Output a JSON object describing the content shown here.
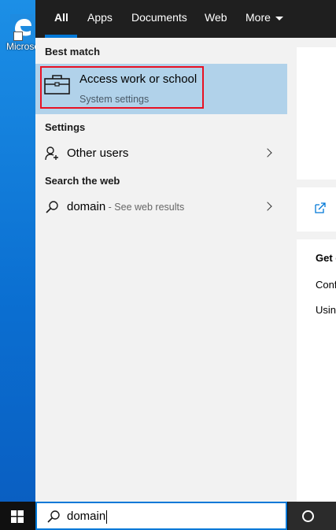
{
  "desktop": {
    "icon_label": "Microsoft Edge"
  },
  "tabs": [
    {
      "label": "All",
      "active": true
    },
    {
      "label": "Apps"
    },
    {
      "label": "Documents"
    },
    {
      "label": "Web"
    },
    {
      "label": "More"
    }
  ],
  "results": {
    "best_match_header": "Best match",
    "best_match": {
      "title": "Access work or school",
      "subtitle": "System settings",
      "icon": "briefcase-icon"
    },
    "settings_header": "Settings",
    "settings_items": [
      {
        "label": "Other users",
        "icon": "person-add-icon"
      }
    ],
    "web_header": "Search the web",
    "web_items": [
      {
        "query": "domain",
        "hint": " - See web results",
        "icon": "search-icon"
      }
    ]
  },
  "preview": {
    "heading_partial": "Get d",
    "line1_partial": "Conf",
    "line2_partial": "Usin"
  },
  "taskbar": {
    "search_value": "domain"
  },
  "colors": {
    "accent": "#0078d7",
    "highlight": "#b1d2ea",
    "outline": "#e81123"
  }
}
